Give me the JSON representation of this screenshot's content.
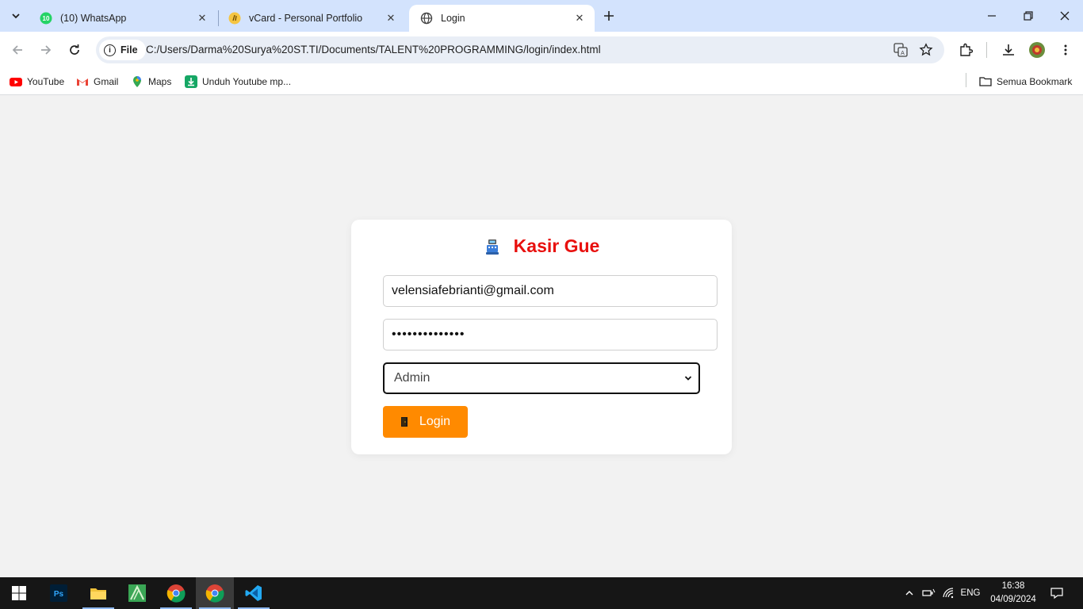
{
  "browser": {
    "tabs": [
      {
        "title": "(10) WhatsApp",
        "icon": "whatsapp-icon",
        "badge": "10",
        "active": false
      },
      {
        "title": "vCard - Personal Portfolio",
        "icon": "vcard-icon",
        "active": false
      },
      {
        "title": "Login",
        "icon": "globe-icon",
        "active": true
      }
    ],
    "address": {
      "scheme_label": "File",
      "url": "C:/Users/Darma%20Surya%20ST.TI/Documents/TALENT%20PROGRAMMING/login/index.html"
    },
    "bookmarks": [
      {
        "label": "YouTube",
        "icon": "youtube-icon"
      },
      {
        "label": "Gmail",
        "icon": "gmail-icon"
      },
      {
        "label": "Maps",
        "icon": "maps-icon"
      },
      {
        "label": "Unduh Youtube mp...",
        "icon": "download-icon"
      }
    ],
    "all_bookmarks_label": "Semua Bookmark"
  },
  "login": {
    "title": "Kasir Gue",
    "title_icon": "cash-register-icon",
    "email_value": "velensiafebrianti@gmail.com",
    "password_value": "••••••••••••••",
    "role_selected": "Admin",
    "button_label": "Login",
    "button_icon": "door-icon"
  },
  "taskbar": {
    "apps": [
      "windows-start-icon",
      "photoshop-icon",
      "file-explorer-icon",
      "green-app-icon",
      "chrome-icon",
      "chrome-icon",
      "vscode-icon"
    ],
    "language": "ENG",
    "time": "16:38",
    "date": "04/09/2024"
  },
  "colors": {
    "tabstrip": "#d3e3fd",
    "title_red": "#e8100e",
    "button_orange": "#ff8a00",
    "page_bg": "#f2f2f2",
    "taskbar": "#161616"
  }
}
